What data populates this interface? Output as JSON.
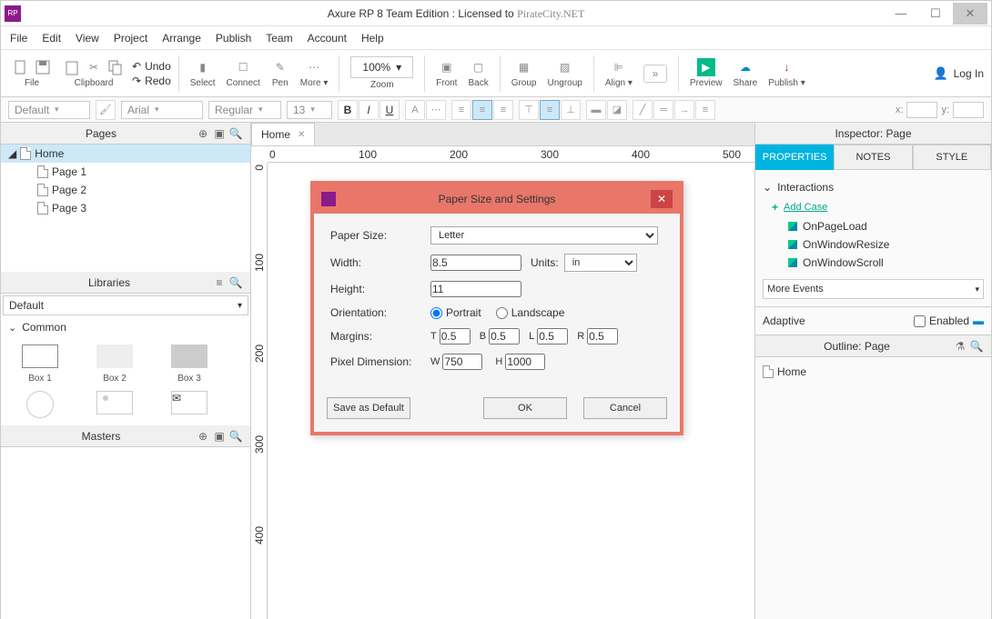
{
  "title": {
    "prefix": "Axure RP 8 Team Edition : Licensed to ",
    "brand": "PirateCity.NET"
  },
  "menu": [
    "File",
    "Edit",
    "View",
    "Project",
    "Arrange",
    "Publish",
    "Team",
    "Account",
    "Help"
  ],
  "toolbar": {
    "file": "File",
    "clipboard": "Clipboard",
    "undo": "Undo",
    "redo": "Redo",
    "select": "Select",
    "connect": "Connect",
    "pen": "Pen",
    "more": "More ▾",
    "zoom_val": "100%",
    "zoom": "Zoom",
    "front": "Front",
    "back": "Back",
    "group": "Group",
    "ungroup": "Ungroup",
    "align": "Align ▾",
    "preview": "Preview",
    "share": "Share",
    "publish": "Publish ▾",
    "login": "Log In"
  },
  "fmt": {
    "style": "Default",
    "font": "Arial",
    "weight": "Regular",
    "size": "13"
  },
  "pages": {
    "title": "Pages",
    "items": [
      "Home",
      "Page 1",
      "Page 2",
      "Page 3"
    ]
  },
  "libs": {
    "title": "Libraries",
    "selected": "Default",
    "section": "Common",
    "shapes": [
      "Box 1",
      "Box 2",
      "Box 3"
    ]
  },
  "masters": {
    "title": "Masters"
  },
  "canvas": {
    "tab": "Home",
    "ruler_h": [
      0,
      100,
      200,
      300,
      400,
      500
    ],
    "ruler_v": [
      0,
      100,
      200,
      300,
      400
    ]
  },
  "inspector": {
    "title": "Inspector: Page",
    "tabs": [
      "PROPERTIES",
      "NOTES",
      "STYLE"
    ],
    "interactions": "Interactions",
    "add_case": "Add Case",
    "events": [
      "OnPageLoad",
      "OnWindowResize",
      "OnWindowScroll"
    ],
    "more": "More Events",
    "adaptive": "Adaptive",
    "enabled": "Enabled",
    "outline": "Outline: Page",
    "outline_item": "Home"
  },
  "dialog": {
    "title": "Paper Size and Settings",
    "paper_size_lbl": "Paper Size:",
    "paper_size": "Letter",
    "width_lbl": "Width:",
    "width": "8.5",
    "units_lbl": "Units:",
    "units": "in",
    "height_lbl": "Height:",
    "height": "11",
    "orient_lbl": "Orientation:",
    "portrait": "Portrait",
    "landscape": "Landscape",
    "margins_lbl": "Margins:",
    "mt": "0.5",
    "mb": "0.5",
    "ml": "0.5",
    "mr": "0.5",
    "pxdim_lbl": "Pixel Dimension:",
    "pxw": "750",
    "pxh": "1000",
    "save_default": "Save as Default",
    "ok": "OK",
    "cancel": "Cancel"
  }
}
